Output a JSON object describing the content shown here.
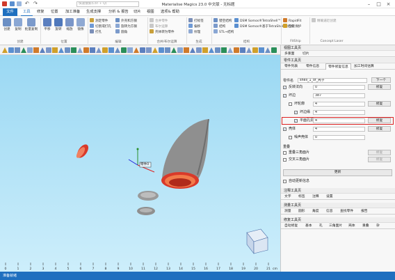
{
  "app": {
    "title": "Materialise Magics 23.0 中文版 - 无标题"
  },
  "search": {
    "placeholder": "快速搜索(Ctrl + Q)"
  },
  "menu": [
    "文件",
    "工具",
    "修复",
    "位置",
    "加工准备",
    "生成支撑",
    "分析 & 报告",
    "切片",
    "视图",
    "选项& 帮助"
  ],
  "ribbon": {
    "big_buttons": [
      "创建",
      "复制",
      "批量复制",
      "平移",
      "旋转",
      "缩放",
      "镜像"
    ],
    "small_col1": [
      "测定零件",
      "切割或打孔",
      "打孔"
    ],
    "small_col2": [
      "外壳和方钢",
      "旋转为方钢",
      "圆角"
    ],
    "small_col3": [
      "合并零件",
      "布尔运算",
      "壳体转为零件"
    ],
    "small_col4": [
      "打标签",
      "偏移",
      "纹理"
    ],
    "small_col5": [
      "镂空结构",
      "结构",
      "STL→结构"
    ],
    "small_col6": [
      "DSM Somos®TetraShell™",
      "DSM Somos®基于TetraShell™结构"
    ],
    "small_col7": [
      "RapidFit",
      "包装保护"
    ],
    "small_col8": [
      "精确逼近创建"
    ],
    "groups": [
      "创建",
      "位置",
      "编辑",
      "合并/布尔运算",
      "生成",
      "结构",
      "FitShip",
      "Concept Laser"
    ]
  },
  "viewport": {
    "ruler_ticks": [
      "0",
      "1",
      "2",
      "3",
      "4",
      "5",
      "6",
      "7",
      "8",
      "9",
      "10",
      "11",
      "12",
      "13",
      "14",
      "15",
      "16",
      "17",
      "18",
      "19",
      "20",
      "21"
    ],
    "ruler_unit": "cm",
    "part_label": "零件0"
  },
  "panel": {
    "view_tools": "视图工具页",
    "view_tabs": [
      "多重面",
      "切片"
    ],
    "part_tools": "零件工具页",
    "part_tabs": [
      "零件列表",
      "零件信息",
      "零件修复信息",
      "加工时间估算"
    ],
    "part_name_label": "零件名",
    "part_name_value": "shell_1_of_壳子",
    "next_button": "下一个",
    "rows": [
      {
        "label": "反转法向",
        "value": "0",
        "action": "修复",
        "checked": true
      },
      {
        "label": "坏边",
        "value": "387",
        "action": "",
        "checked": true
      },
      {
        "label": "坏轮廓",
        "value": "4",
        "action": "修复",
        "checked": false
      },
      {
        "label": "坏边缘",
        "value": "4",
        "action": "",
        "checked": true
      },
      {
        "label": "平面孔洞",
        "value": "4",
        "action": "修复",
        "checked": true
      },
      {
        "label": "壳体",
        "value": "4",
        "action": "修复",
        "checked": true
      },
      {
        "label": "噪声壳体",
        "value": "0",
        "action": "",
        "checked": false
      }
    ],
    "overlap_section": "重叠",
    "overlap_rows": [
      "重叠三角面片",
      "交叉三角面片"
    ],
    "update_button": "更新",
    "auto_update": "自动更新信息",
    "annotation_tools": "注释工具页",
    "annotation_tabs": [
      "文字",
      "标签",
      "注释",
      "设置"
    ],
    "measure_tools": "测量工具页",
    "measure_tabs": [
      "测量",
      "圆形",
      "角度",
      "信息",
      "查找零件",
      "报告"
    ],
    "fix_tools": "修复工具页",
    "fix_tabs": [
      "自动修复",
      "基本",
      "孔",
      "三角面片",
      "壳体",
      "重叠",
      "杂"
    ]
  },
  "status": {
    "text": "准备就绪"
  },
  "colors": {
    "accent": "#1e6fbf",
    "highlight": "#d22222",
    "sky_top": "#9ad8f3",
    "sky_bottom": "#cdeefb",
    "part_red": "#d93a2a",
    "part_gray": "#8f8f8f"
  }
}
